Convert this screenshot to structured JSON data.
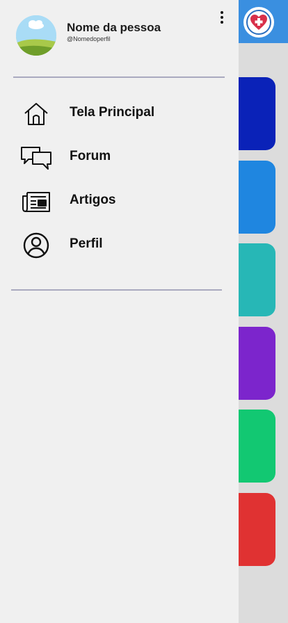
{
  "user": {
    "name": "Nome da pessoa",
    "handle": "@Nomedoperfil"
  },
  "menu": {
    "items": [
      {
        "label": "Tela Principal",
        "icon": "home-icon"
      },
      {
        "label": "Forum",
        "icon": "chat-bubbles-icon"
      },
      {
        "label": "Artigos",
        "icon": "newspaper-icon"
      },
      {
        "label": "Perfil",
        "icon": "user-circle-icon"
      }
    ]
  },
  "background": {
    "accent": "#3a8fe0",
    "cards": [
      {
        "color": "#0a22b8"
      },
      {
        "color": "#1f86e0"
      },
      {
        "color": "#27b7b6"
      },
      {
        "color": "#7c25cc"
      },
      {
        "color": "#12c872"
      },
      {
        "color": "#e03232"
      }
    ]
  }
}
